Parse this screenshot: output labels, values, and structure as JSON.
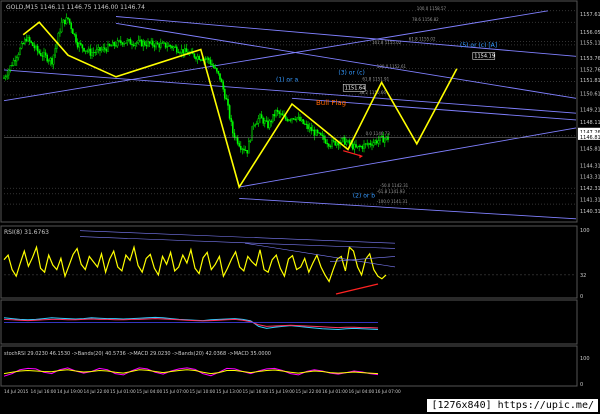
{
  "header": {
    "symbol_text": "GOLD,M15  1146.11 1146.75 1146.00 1146.74"
  },
  "colors": {
    "bull": "#00ff00",
    "bear": "#00ff00",
    "wave": "#ffff00",
    "channel": "#8080ff",
    "rsi": "#ffff00",
    "fib": "#666666",
    "bg": "#000000",
    "axis": "#cccccc",
    "orange": "#ff6600",
    "cyan_label": "#3399ff",
    "arrow_red": "#ff2222"
  },
  "chart_data": [
    {
      "type": "candlestick",
      "panel": "main",
      "ylim": [
        1139.5,
        1158.5
      ],
      "y_ticks": [
        "1157.61",
        "1156.05",
        "1155.11",
        "1153.76",
        "1152.76",
        "1151.81",
        "1150.61",
        "1149.21",
        "1148.11",
        "1147.26",
        "1146.81",
        "1145.81",
        "1144.31",
        "1143.31",
        "1142.31",
        "1141.31",
        "1140.31"
      ],
      "highlight_ticks": [
        "1147.26",
        "1146.81"
      ],
      "n_bars": 170,
      "close_path": [
        [
          0,
          1152.0
        ],
        [
          8,
          1154.0
        ],
        [
          14,
          1155.5
        ],
        [
          22,
          1154.2
        ],
        [
          30,
          1153.5
        ],
        [
          36,
          1156.8
        ],
        [
          40,
          1157.2
        ],
        [
          46,
          1155.0
        ],
        [
          54,
          1154.2
        ],
        [
          62,
          1154.5
        ],
        [
          74,
          1155.2
        ],
        [
          90,
          1155.0
        ],
        [
          104,
          1154.8
        ],
        [
          118,
          1154.0
        ],
        [
          128,
          1153.6
        ],
        [
          135,
          1152.0
        ],
        [
          139,
          1150.0
        ],
        [
          143,
          1147.2
        ],
        [
          148,
          1146.0
        ],
        [
          152,
          1145.6
        ],
        [
          156,
          1148.0
        ],
        [
          160,
          1148.5
        ],
        [
          165,
          1147.8
        ],
        [
          170,
          1149.0
        ],
        [
          176,
          1148.4
        ],
        [
          182,
          1148.6
        ],
        [
          190,
          1147.6
        ],
        [
          196,
          1147.0
        ],
        [
          204,
          1146.2
        ],
        [
          212,
          1146.5
        ],
        [
          220,
          1145.8
        ],
        [
          228,
          1146.2
        ],
        [
          236,
          1146.6
        ],
        [
          240,
          1146.7
        ]
      ],
      "wave_lines": [
        [
          [
            12,
            1155.8
          ],
          [
            22,
            1156.9
          ],
          [
            40,
            1154.0
          ],
          [
            70,
            1152.1
          ],
          [
            123,
            1154.5
          ],
          [
            147,
            1142.4
          ],
          [
            180,
            1149.7
          ],
          [
            215,
            1145.7
          ],
          [
            236,
            1151.6
          ],
          [
            258,
            1146.2
          ],
          [
            283,
            1152.8
          ]
        ]
      ],
      "annotations": [
        {
          "text": "(1) or a",
          "x": 170,
          "y": 1151.7,
          "color": "#3399ff"
        },
        {
          "text": "(3) or (c)",
          "x": 209,
          "y": 1152.3,
          "color": "#3399ff"
        },
        {
          "text": "(5) or (c) [A]",
          "x": 285,
          "y": 1154.7,
          "color": "#3399ff"
        },
        {
          "text": "(2) or b",
          "x": 218,
          "y": 1141.5,
          "color": "#3399ff"
        },
        {
          "text": "Bull Flag",
          "x": 195,
          "y": 1149.6,
          "color": "#ff6600"
        }
      ],
      "price_boxes": [
        {
          "text": "1151.64",
          "x": 212,
          "y": 1151.0
        },
        {
          "text": "1154.19",
          "x": 293,
          "y": 1153.8
        }
      ],
      "fib_labels": [
        {
          "text": "100.0  1158.57",
          "x": 258,
          "y": 1157.9
        },
        {
          "text": "78.6  1156.82",
          "x": 255,
          "y": 1156.9
        },
        {
          "text": "61.8  1155.02",
          "x": 253,
          "y": 1155.2
        },
        {
          "text": "161.8  1155.02",
          "x": 230,
          "y": 1154.9
        },
        {
          "text": "100.0  1152.61",
          "x": 233,
          "y": 1152.8
        },
        {
          "text": "61.8  1151.91",
          "x": 224,
          "y": 1151.7
        },
        {
          "text": "38.2  1150.66",
          "x": 222,
          "y": 1150.5
        },
        {
          "text": "0.0  1146.73",
          "x": 226,
          "y": 1146.9
        },
        {
          "text": "-50.0  1142.31",
          "x": 235,
          "y": 1142.3
        },
        {
          "text": "-61.8  1141.93",
          "x": 233,
          "y": 1141.8
        },
        {
          "text": "-100.0  1141.31",
          "x": 233,
          "y": 1140.9
        }
      ]
    },
    {
      "type": "line",
      "panel": "rsi",
      "label": "RSI(8) 31.6763",
      "ylim": [
        0,
        100
      ],
      "y_ticks": [
        "100",
        "32",
        "0"
      ],
      "series": [
        {
          "values": [
            55,
            62,
            40,
            30,
            50,
            68,
            45,
            58,
            74,
            42,
            36,
            62,
            47,
            40,
            57,
            30,
            46,
            63,
            72,
            48,
            40,
            60,
            52,
            44,
            64,
            36,
            56,
            68,
            44,
            38,
            62,
            54,
            74,
            46,
            36,
            57,
            63,
            42,
            32,
            60,
            48,
            66,
            38,
            44,
            62,
            50,
            70,
            42,
            34,
            58,
            66,
            40,
            48,
            60,
            30,
            42,
            56,
            67,
            44,
            38,
            60,
            52,
            46,
            70,
            40,
            36,
            55,
            62,
            42,
            30,
            56,
            61,
            40,
            44,
            57,
            36,
            50,
            62,
            44,
            32,
            22,
            40,
            56,
            60,
            38,
            74,
            68,
            44,
            32,
            56,
            64,
            40,
            30,
            26,
            32
          ]
        }
      ]
    },
    {
      "type": "line",
      "panel": "middle",
      "label": "",
      "ylim": [
        0,
        100
      ],
      "series": [
        {
          "values": [
            62,
            60,
            58,
            57,
            58,
            60,
            62,
            61,
            60,
            59,
            60,
            62,
            61,
            60,
            60,
            59,
            60,
            61,
            62,
            63,
            62,
            60,
            58,
            57,
            56,
            55,
            57,
            58,
            59,
            60,
            58,
            54,
            40,
            35,
            38,
            40,
            42,
            40,
            38,
            36,
            34,
            33,
            32,
            34,
            35,
            34,
            33,
            32
          ]
        },
        {
          "values": [
            58,
            57,
            56,
            55,
            56,
            57,
            58,
            58,
            57,
            57,
            58,
            59,
            58,
            58,
            57,
            57,
            58,
            58,
            59,
            60,
            59,
            58,
            57,
            56,
            55,
            54,
            55,
            56,
            57,
            58,
            56,
            52,
            44,
            40,
            41,
            42,
            43,
            42,
            41,
            40,
            39,
            38,
            37,
            38,
            38,
            37,
            37,
            36
          ]
        }
      ]
    },
    {
      "type": "line",
      "panel": "bottom",
      "label": "stochRSI 29.0230 46.1530   ->Bands(20) 40.5736   ->MACD 29.0230 ->Bands(20) 42.0368   ->MACD 35.0000",
      "ylim": [
        0,
        100
      ],
      "y_ticks": [
        "100",
        "0"
      ],
      "series": [
        {
          "values": [
            30,
            40,
            55,
            60,
            58,
            45,
            40,
            55,
            62,
            50,
            42,
            48,
            60,
            55,
            40,
            35,
            50,
            62,
            58,
            45,
            38,
            50,
            58,
            62,
            56,
            40,
            32,
            45,
            60,
            58,
            48,
            40,
            50,
            58,
            60,
            52,
            40,
            35,
            48,
            55,
            50,
            42,
            38,
            44,
            50,
            46,
            40,
            36
          ]
        },
        {
          "values": [
            40,
            45,
            50,
            52,
            50,
            48,
            47,
            52,
            55,
            50,
            46,
            48,
            52,
            50,
            45,
            42,
            48,
            55,
            53,
            48,
            44,
            48,
            52,
            55,
            52,
            45,
            40,
            44,
            52,
            52,
            48,
            44,
            48,
            52,
            54,
            50,
            45,
            42,
            46,
            50,
            48,
            44,
            42,
            44,
            46,
            44,
            42,
            40
          ]
        }
      ]
    }
  ],
  "x_axis": {
    "labels": [
      "14 Jul 2015",
      "14 Jul 16:00",
      "14 Jul 19:00",
      "14 Jul 22:00",
      "15 Jul 01:00",
      "15 Jul 04:00",
      "15 Jul 07:00",
      "15 Jul 10:00",
      "15 Jul 13:00",
      "15 Jul 16:00",
      "15 Jul 19:00",
      "15 Jul 22:00",
      "16 Jul 01:00",
      "16 Jul 04:00",
      "16 Jul 07:00"
    ]
  },
  "watermark": "[1276x840] https://upic.me/"
}
